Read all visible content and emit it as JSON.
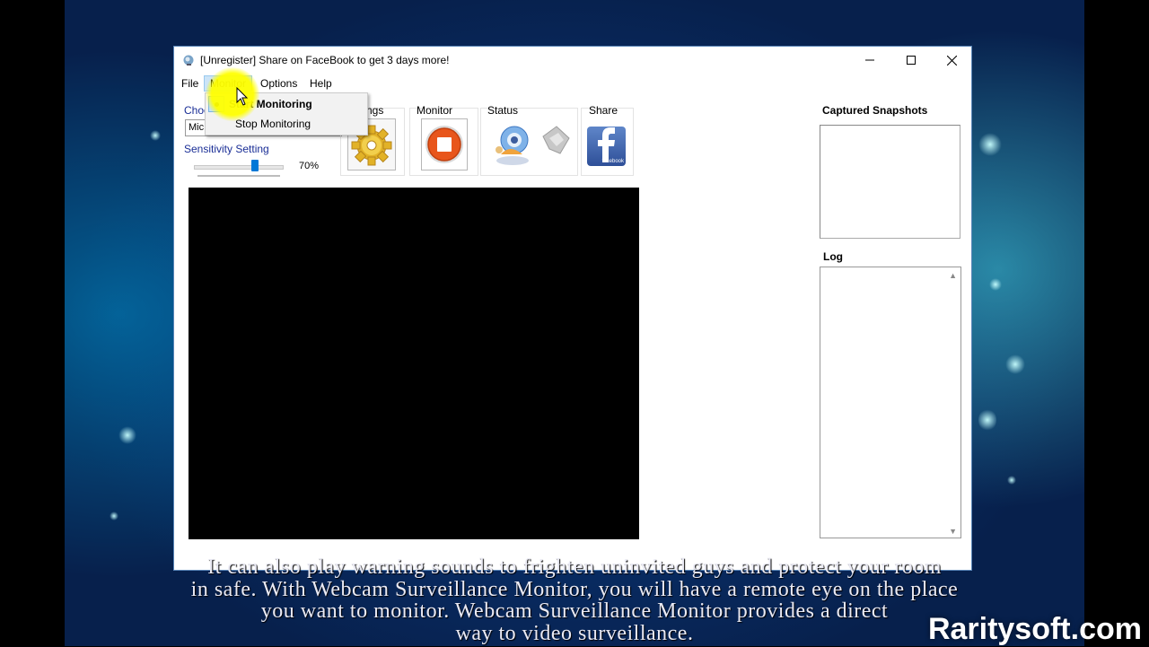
{
  "window": {
    "title": "[Unregister] Share on FaceBook to get 3 days more!",
    "accent": "#0078d7"
  },
  "menubar": {
    "file": "File",
    "monitor": "Monitor",
    "options": "Options",
    "help": "Help"
  },
  "monitor_menu": {
    "start": "Start Monitoring",
    "stop": "Stop Monitoring",
    "checked": "start"
  },
  "device": {
    "label": "Choo",
    "value": "Mic"
  },
  "sensitivity": {
    "label": "Sensitivity Setting",
    "value_text": "70%",
    "value": 70
  },
  "toolbar": {
    "settings_label": "ngs",
    "monitor_label": "Monitor",
    "status_label": "Status",
    "share_label": "Share",
    "facebook_badge": "facebook"
  },
  "panels": {
    "snapshots_label": "Captured Snapshots",
    "log_label": "Log"
  },
  "video_caption": {
    "lines": [
      "It can also play warning sounds to frighten uninvited guys and protect your room",
      "in safe. With Webcam Surveillance Monitor, you will have a remote eye on the place",
      "you want to monitor. Webcam Surveillance Monitor provides a direct",
      "way to video surveillance."
    ]
  },
  "watermark": "Raritysoft.com"
}
